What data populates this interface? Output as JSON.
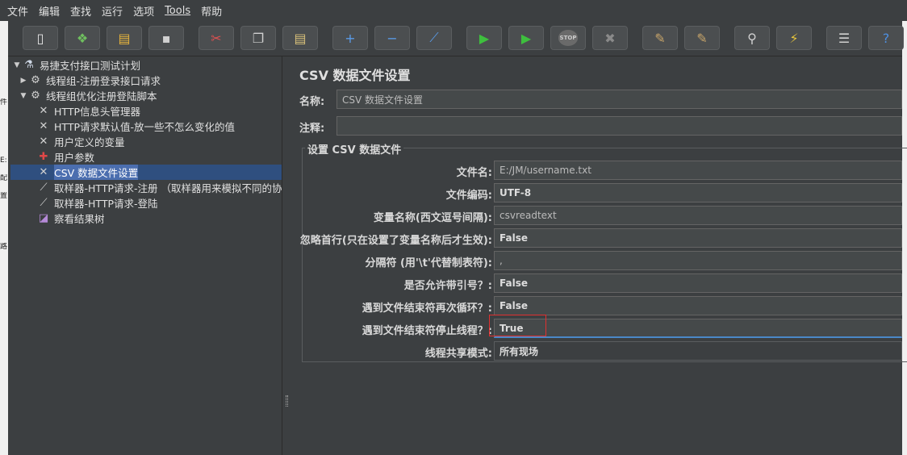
{
  "menu": [
    "文件",
    "编辑",
    "查找",
    "运行",
    "选项",
    "Tools",
    "帮助"
  ],
  "left_strip_fragments": [
    "件",
    "E:",
    "配",
    "置",
    "路"
  ],
  "toolbar": {
    "buttons": [
      {
        "name": "new-icon",
        "glyph": "▯",
        "color": "#e8e8e8"
      },
      {
        "name": "templates-icon",
        "glyph": "❖",
        "color": "#6fbf5f"
      },
      {
        "name": "open-icon",
        "glyph": "▤",
        "color": "#e6b33c"
      },
      {
        "name": "save-icon",
        "glyph": "▪",
        "color": "#d0d0d0"
      },
      {
        "name": "cut-icon",
        "glyph": "✂",
        "color": "#e05050"
      },
      {
        "name": "copy-icon",
        "glyph": "❐",
        "color": "#d0d0d0"
      },
      {
        "name": "paste-icon",
        "glyph": "▤",
        "color": "#d8c07a"
      },
      {
        "name": "expand-icon",
        "glyph": "+",
        "color": "#5a9be8"
      },
      {
        "name": "collapse-icon",
        "glyph": "−",
        "color": "#5a9be8"
      },
      {
        "name": "toggle-icon",
        "glyph": "⟋",
        "color": "#5a9be8"
      },
      {
        "name": "start-icon",
        "glyph": "▶",
        "color": "#3ebf3e"
      },
      {
        "name": "start-no-pauses-icon",
        "glyph": "▶",
        "color": "#3ebf3e"
      },
      {
        "name": "stop-icon",
        "glyph": "STOP",
        "color": "#8a8a8a"
      },
      {
        "name": "shutdown-icon",
        "glyph": "✖",
        "color": "#8a8a8a"
      },
      {
        "name": "clear-icon",
        "glyph": "✎",
        "color": "#c8a56a"
      },
      {
        "name": "clear-all-icon",
        "glyph": "✎",
        "color": "#c8a56a"
      },
      {
        "name": "search-icon",
        "glyph": "⚲",
        "color": "#d0d0d0"
      },
      {
        "name": "reset-search-icon",
        "glyph": "⚡",
        "color": "#e6c43c"
      },
      {
        "name": "function-helper-icon",
        "glyph": "☰",
        "color": "#d0d0d0"
      },
      {
        "name": "help-icon",
        "glyph": "?",
        "color": "#4d8fe0"
      }
    ]
  },
  "tree": [
    {
      "label": "易捷支付接口测试计划",
      "arrow": "▼",
      "icon": "flask-icon",
      "glyph": "⚗",
      "color": "#cfd8e6",
      "indent": 0
    },
    {
      "label": "线程组-注册登录接口请求",
      "arrow": "▶",
      "icon": "gear-icon",
      "glyph": "⚙",
      "color": "#d0d0d0",
      "indent": 1
    },
    {
      "label": "线程组优化注册登陆脚本",
      "arrow": "▼",
      "icon": "gear-icon",
      "glyph": "⚙",
      "color": "#d0d0d0",
      "indent": 1
    },
    {
      "label": "HTTP信息头管理器",
      "arrow": "",
      "icon": "wrench-icon",
      "glyph": "✕",
      "color": "#d0d0d0",
      "indent": 2
    },
    {
      "label": "HTTP请求默认值-放一些不怎么变化的值",
      "arrow": "",
      "icon": "wrench-icon",
      "glyph": "✕",
      "color": "#d0d0d0",
      "indent": 2
    },
    {
      "label": "用户定义的变量",
      "arrow": "",
      "icon": "wrench-icon",
      "glyph": "✕",
      "color": "#d0d0d0",
      "indent": 2
    },
    {
      "label": "用户参数",
      "arrow": "",
      "icon": "preprocessor-icon",
      "glyph": "✚",
      "color": "#e04848",
      "indent": 2
    },
    {
      "label": "CSV 数据文件设置",
      "arrow": "",
      "icon": "wrench-icon",
      "glyph": "✕",
      "color": "#d0d0d0",
      "indent": 2,
      "selected": true
    },
    {
      "label": "取样器-HTTP请求-注册 （取样器用来模拟不同的协议",
      "arrow": "",
      "icon": "pipette-icon",
      "glyph": "⟋",
      "color": "#d0d0d0",
      "indent": 2
    },
    {
      "label": "取样器-HTTP请求-登陆",
      "arrow": "",
      "icon": "pipette-icon",
      "glyph": "⟋",
      "color": "#d0d0d0",
      "indent": 2
    },
    {
      "label": "察看结果树",
      "arrow": "",
      "icon": "chart-icon",
      "glyph": "◪",
      "color": "#b58ad8",
      "indent": 2
    }
  ],
  "panel": {
    "title": "CSV 数据文件设置",
    "name_label": "名称:",
    "name_value": "CSV 数据文件设置",
    "comment_label": "注释:",
    "comment_value": "",
    "section_title": "设置 CSV 数据文件",
    "fields": [
      {
        "key": "filename",
        "label": "文件名:",
        "value": "E:/JM/username.txt",
        "bold": false
      },
      {
        "key": "encoding",
        "label": "文件编码:",
        "value": "UTF-8",
        "bold": true
      },
      {
        "key": "varnames",
        "label": "变量名称(西文逗号间隔):",
        "value": "csvreadtext",
        "bold": false
      },
      {
        "key": "ignore_first",
        "label": "忽略首行(只在设置了变量名称后才生效):",
        "value": "False",
        "bold": true
      },
      {
        "key": "delimiter",
        "label": "分隔符 (用'\\t'代替制表符):",
        "value": ",",
        "bold": false
      },
      {
        "key": "quoted",
        "label": "是否允许带引号？:",
        "value": "False",
        "bold": true
      },
      {
        "key": "recycle",
        "label": "遇到文件结束符再次循环？:",
        "value": "False",
        "bold": true
      },
      {
        "key": "stop_thread",
        "label": "遇到文件结束符停止线程？:",
        "value": "True",
        "bold": true
      },
      {
        "key": "sharing",
        "label": "线程共享模式:",
        "value": "所有现场",
        "bold": true
      }
    ]
  }
}
